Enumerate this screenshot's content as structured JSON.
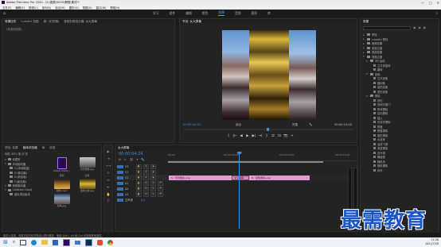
{
  "app": {
    "title": "Adobe Premiere Pro 2020 - D:\\视频\\5005\\教程\\素材 *",
    "menus": [
      "文件(F)",
      "编辑(E)",
      "剪辑(C)",
      "序列(S)",
      "标记(M)",
      "图形(G)",
      "视图(V)",
      "窗口(W)",
      "帮助(H)"
    ],
    "workspaces": [
      "学习",
      "组件",
      "编辑",
      "颜色",
      "效果",
      "音频",
      "图形",
      "库"
    ],
    "active_workspace": "效果"
  },
  "source_panel": {
    "tabs": [
      "效果控件",
      "Lumetri 范围",
      "源: (无剪辑)",
      "音频剪辑混合器: 女大屏幕"
    ],
    "active_tab": "效果控件",
    "subtitle": "(未选择剪辑)"
  },
  "program_monitor": {
    "tab": "节目: 女大屏幕",
    "timecode_left": "00:00:04:24",
    "fit": "适合",
    "quality": "完整",
    "timecode_right": "00:00:10:00",
    "controls": [
      "{",
      "|←",
      "◀",
      "▶",
      "▶|",
      "→|",
      "}",
      "⇄",
      "⊡",
      "📷",
      "+"
    ]
  },
  "effects_panel": {
    "tab": "效果",
    "search_placeholder": "",
    "items": [
      {
        "label": "预设",
        "level": 0
      },
      {
        "label": "Lumetri 预设",
        "level": 0
      },
      {
        "label": "音频效果",
        "level": 0
      },
      {
        "label": "音频过渡",
        "level": 0
      },
      {
        "label": "视频效果",
        "level": 0
      },
      {
        "label": "视频过渡",
        "level": 0
      },
      {
        "label": "3D 运动",
        "level": 1
      },
      {
        "label": "立方体旋转",
        "level": 2
      },
      {
        "label": "翻转",
        "level": 2
      },
      {
        "label": "划像",
        "level": 1
      },
      {
        "label": "交叉划像",
        "level": 2
      },
      {
        "label": "圆划像",
        "level": 2
      },
      {
        "label": "盒形划像",
        "level": 2
      },
      {
        "label": "菱形划像",
        "level": 2
      },
      {
        "label": "擦除",
        "level": 1
      },
      {
        "label": "划出",
        "level": 2
      },
      {
        "label": "双侧平推门",
        "level": 2
      },
      {
        "label": "带状擦除",
        "level": 2
      },
      {
        "label": "径向擦除",
        "level": 2
      },
      {
        "label": "插入",
        "level": 2
      },
      {
        "label": "时钟式擦除",
        "level": 2
      },
      {
        "label": "棋盘",
        "level": 2
      },
      {
        "label": "棋盘擦除",
        "level": 2
      },
      {
        "label": "楔形擦除",
        "level": 2
      },
      {
        "label": "水波块",
        "level": 2
      },
      {
        "label": "油漆飞溅",
        "level": 2
      },
      {
        "label": "渐变擦除",
        "level": 2
      },
      {
        "label": "百叶窗",
        "level": 2
      },
      {
        "label": "螺旋框",
        "level": 2
      },
      {
        "label": "随机块",
        "level": 2
      },
      {
        "label": "随机擦除",
        "level": 2
      },
      {
        "label": "风车",
        "level": 2
      }
    ]
  },
  "project_panel": {
    "tabs": [
      "项目: 效果",
      "媒体浏览器",
      "库",
      "信息"
    ],
    "active_tab": "媒体浏览器",
    "path": "电脑 (BIN) 备 测 视",
    "tree": [
      {
        "label": "收藏夹",
        "level": 0
      },
      {
        "label": "本地驱动器",
        "level": 0
      },
      {
        "label": "C:(本地磁盘)",
        "level": 1
      },
      {
        "label": "D:(新加卷)",
        "level": 1
      },
      {
        "label": "E:(新加卷)",
        "level": 1
      },
      {
        "label": "F:(新加卷)",
        "level": 1
      },
      {
        "label": "网络驱动器",
        "level": 0
      },
      {
        "label": "Creative Cloud",
        "level": 0
      },
      {
        "label": "团队项目版本",
        "level": 1
      }
    ],
    "thumbs": [
      {
        "label": "Adobe Premi...",
        "kind": "pr"
      },
      {
        "label": "背景重叠.jpg",
        "kind": "img1"
      },
      {
        "label": "序列",
        "kind": "empty"
      },
      {
        "label": "宣传",
        "kind": "empty"
      },
      {
        "label": "建筑.mp4",
        "kind": "img2"
      },
      {
        "label": "金色大屏.jpg",
        "kind": "img3"
      },
      {
        "label": "建筑.jpg",
        "kind": "img4"
      }
    ]
  },
  "timeline": {
    "tab": "女大屏幕",
    "timecode": "00:00:04:24",
    "ruler": [
      "00:00",
      "00:00:05:00",
      "00:00:10:00",
      "00:00:15:00"
    ],
    "tracks": [
      {
        "label": "V3",
        "type": "video"
      },
      {
        "label": "V2",
        "type": "video"
      },
      {
        "label": "V1",
        "type": "video"
      },
      {
        "label": "A1",
        "type": "audio"
      },
      {
        "label": "A2",
        "type": "audio"
      },
      {
        "label": "A3",
        "type": "audio"
      },
      {
        "label": "主声道",
        "type": "master"
      }
    ],
    "clips": [
      {
        "label": "背景重叠.png",
        "track": "V1"
      },
      {
        "label": "交叉溶解",
        "track": "V1"
      },
      {
        "label": "建筑重叠.png",
        "track": "V1"
      }
    ],
    "master_value": "0.0"
  },
  "status_bar": {
    "text": "单击以选择，或单击空白处并拖动以进行框选。使用 Shift、Alt 和 Ctrl 可获得其他选项。"
  },
  "watermark": "最需教育",
  "taskbar": {
    "time": "11:30",
    "date": "2021/7/28"
  },
  "colors": {
    "accent": "#3c8bd9",
    "clip": "#e49ad3",
    "clip_transition": "#d08ab8",
    "playhead": "#3c8bd9",
    "watermark": "#1a55c7"
  }
}
